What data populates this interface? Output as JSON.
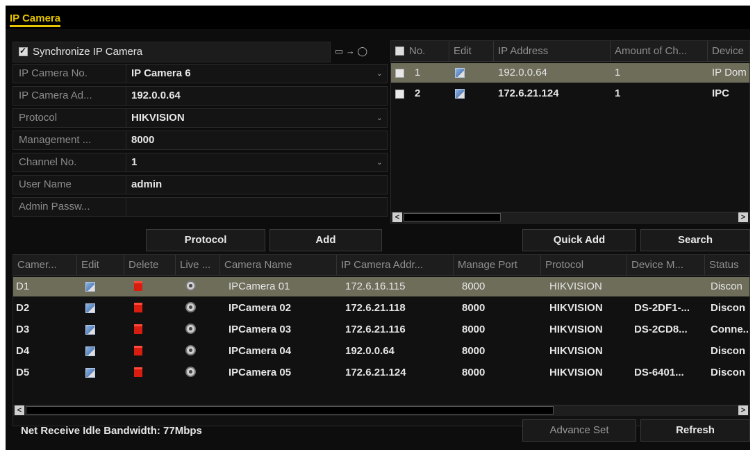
{
  "window": {
    "title": "IP Camera"
  },
  "sync": {
    "label": "Synchronize IP Camera",
    "checked": true,
    "icon": "sync-arrow-icon"
  },
  "form": {
    "rows": [
      {
        "label": "IP Camera No.",
        "value": "IP Camera 6",
        "dropdown": true
      },
      {
        "label": "IP Camera Ad...",
        "value": "192.0.0.64",
        "dropdown": false
      },
      {
        "label": "Protocol",
        "value": "HIKVISION",
        "dropdown": true
      },
      {
        "label": "Management ...",
        "value": "8000",
        "dropdown": false
      },
      {
        "label": "Channel No.",
        "value": "1",
        "dropdown": true
      },
      {
        "label": "User Name",
        "value": "admin",
        "dropdown": false
      },
      {
        "label": "Admin Passw...",
        "value": "",
        "dropdown": false
      }
    ]
  },
  "top_table": {
    "headers": [
      "No.",
      "Edit",
      "IP Address",
      "Amount of Ch...",
      "Device"
    ],
    "rows": [
      {
        "no": "1",
        "ip": "192.0.0.64",
        "amount": "1",
        "device": "IP Dom",
        "selected": true
      },
      {
        "no": "2",
        "ip": "172.6.21.124",
        "amount": "1",
        "device": "IPC",
        "selected": false
      }
    ]
  },
  "buttons": {
    "protocol": "Protocol",
    "add": "Add",
    "quick_add": "Quick Add",
    "search": "Search",
    "advance_set": "Advance Set",
    "refresh": "Refresh"
  },
  "bottom_table": {
    "headers": [
      "Camer...",
      "Edit",
      "Delete",
      "Live ...",
      "Camera Name",
      "IP Camera Addr...",
      "Manage Port",
      "Protocol",
      "Device M...",
      "Status"
    ],
    "rows": [
      {
        "camera": "D1",
        "name": "IPCamera 01",
        "ip": "172.6.16.115",
        "port": "8000",
        "protocol": "HIKVISION",
        "device_model": "",
        "status": "Discon",
        "selected": true
      },
      {
        "camera": "D2",
        "name": "IPCamera 02",
        "ip": "172.6.21.118",
        "port": "8000",
        "protocol": "HIKVISION",
        "device_model": "DS-2DF1-...",
        "status": "Discon",
        "selected": false
      },
      {
        "camera": "D3",
        "name": "IPCamera 03",
        "ip": "172.6.21.116",
        "port": "8000",
        "protocol": "HIKVISION",
        "device_model": "DS-2CD8...",
        "status": "Conne...",
        "selected": false
      },
      {
        "camera": "D4",
        "name": "IPCamera 04",
        "ip": "192.0.0.64",
        "port": "8000",
        "protocol": "HIKVISION",
        "device_model": "",
        "status": "Discon",
        "selected": false
      },
      {
        "camera": "D5",
        "name": "IPCamera 05",
        "ip": "172.6.21.124",
        "port": "8000",
        "protocol": "HIKVISION",
        "device_model": "DS-6401...",
        "status": "Discon",
        "selected": false
      }
    ]
  },
  "status": {
    "bandwidth": "Net Receive Idle Bandwidth: 77Mbps"
  }
}
